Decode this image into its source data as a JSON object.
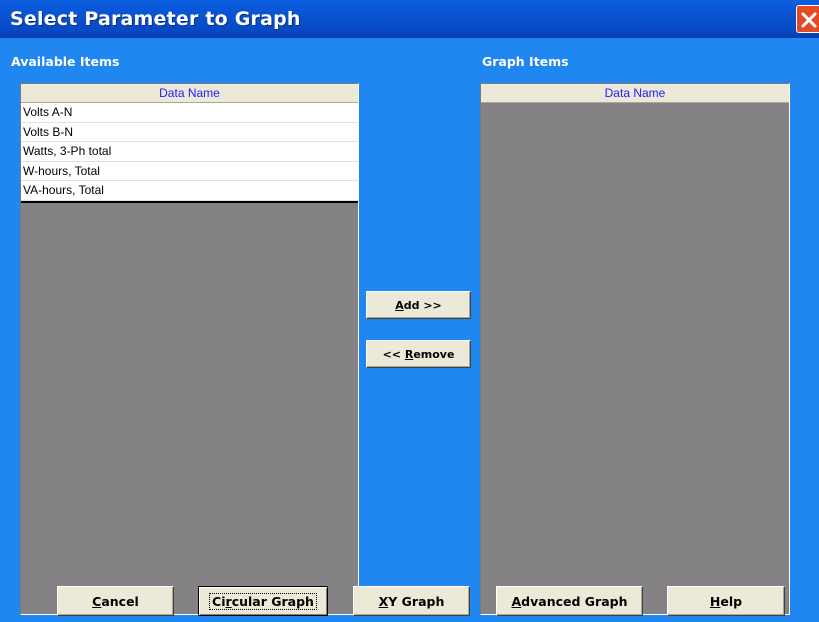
{
  "window": {
    "title": "Select Parameter to Graph"
  },
  "available": {
    "label": "Available Items",
    "column_header": "Data Name",
    "items": [
      "Volts A-N",
      "Volts B-N",
      "Watts, 3-Ph total",
      "W-hours, Total",
      "VA-hours, Total"
    ]
  },
  "graph": {
    "label": "Graph Items",
    "column_header": "Data Name",
    "items": []
  },
  "buttons": {
    "add": {
      "accel": "A",
      "rest": "dd >>"
    },
    "remove": {
      "pre": "<< ",
      "accel": "R",
      "rest": "emove"
    },
    "cancel": {
      "accel": "C",
      "rest": "ancel"
    },
    "circular": {
      "pre": "Ci",
      "accel": "r",
      "rest": "cular Graph"
    },
    "xy": {
      "accel": "X",
      "rest": "Y Graph"
    },
    "advanced": {
      "accel": "A",
      "rest": "dvanced Graph"
    },
    "help": {
      "accel": "H",
      "rest": "elp"
    }
  },
  "colors": {
    "title_bar": "#0a5fe0",
    "dialog_bg": "#1f87ef",
    "list_bg": "#848284",
    "header_text": "#2020ff",
    "close": "#e34a26"
  },
  "icons": {
    "close": "close-x-icon"
  }
}
